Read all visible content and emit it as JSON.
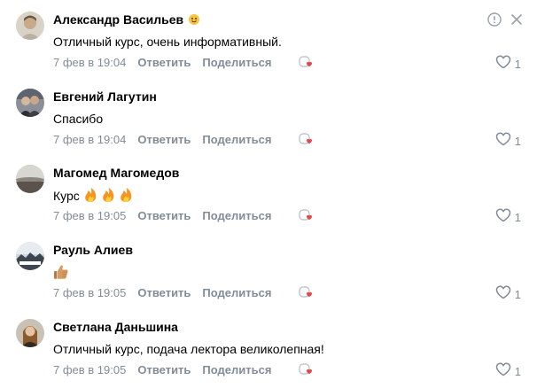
{
  "comments": [
    {
      "author": "Александр Васильев",
      "text": "Отличный курс, очень информативный.",
      "time": "7 фев в 19:04",
      "reply_label": "Ответить",
      "share_label": "Поделиться",
      "likes": "1"
    },
    {
      "author": "Евгений Лагутин",
      "text": "Спасибо",
      "time": "7 фев в 19:04",
      "reply_label": "Ответить",
      "share_label": "Поделиться",
      "likes": "1"
    },
    {
      "author": "Магомед Магомедов",
      "text": "Курс",
      "time": "7 фев в 19:05",
      "reply_label": "Ответить",
      "share_label": "Поделиться",
      "likes": "1"
    },
    {
      "author": "Рауль Алиев",
      "text": "",
      "time": "7 фев в 19:05",
      "reply_label": "Ответить",
      "share_label": "Поделиться",
      "likes": "1"
    },
    {
      "author": "Светлана Даньшина",
      "text": "Отличный курс, подача лектора великолепная!",
      "time": "7 фев в 19:05",
      "reply_label": "Ответить",
      "share_label": "Поделиться",
      "likes": "1"
    }
  ],
  "colors": {
    "meta": "#818c99",
    "icon": "#99a2ad",
    "reaction_heart": "#e64646"
  },
  "icons": {
    "report": "exclamation-circle-icon",
    "close": "close-icon",
    "like": "heart-outline-icon",
    "reaction": "reaction-heart-icon",
    "fire": "fire-emoji",
    "thumbs_up": "thumbs-up-emoji",
    "badge": "emoji-badge"
  }
}
